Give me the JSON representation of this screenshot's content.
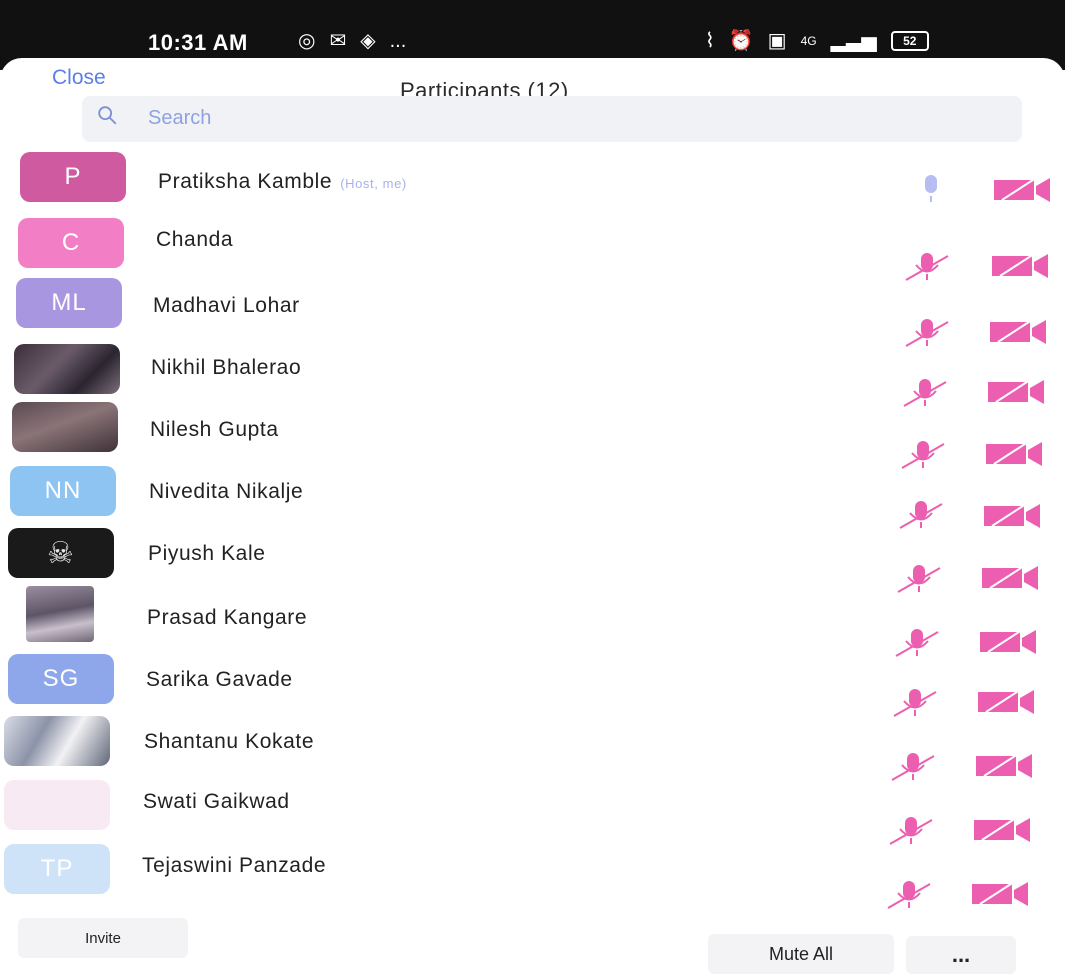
{
  "status_bar": {
    "time": "10:31 AM",
    "dots": "...",
    "network": "4G",
    "battery": "52"
  },
  "header": {
    "close_label": "Close",
    "title": "Participants (12)"
  },
  "search": {
    "placeholder": "Search"
  },
  "participants": [
    {
      "name": "Pratiksha Kamble",
      "tag": "(Host, me)",
      "initials": "P",
      "avatar_color": "#cf5aa0",
      "mic": "on",
      "video": "off"
    },
    {
      "name": "Chanda",
      "initials": "C",
      "avatar_color": "#f27fc5",
      "mic": "off",
      "video": "off"
    },
    {
      "name": "Madhavi Lohar",
      "initials": "ML",
      "avatar_color": "#a996e0",
      "mic": "off",
      "video": "off"
    },
    {
      "name": "Nikhil Bhalerao",
      "avatar_photo": true,
      "mic": "off",
      "video": "off"
    },
    {
      "name": "Nilesh Gupta",
      "avatar_photo": true,
      "mic": "off",
      "video": "off"
    },
    {
      "name": "Nivedita Nikalje",
      "initials": "NN",
      "avatar_color": "#8ec4f2",
      "mic": "off",
      "video": "off"
    },
    {
      "name": "Piyush Kale",
      "avatar_photo": true,
      "mic": "off",
      "video": "off"
    },
    {
      "name": "Prasad Kangare",
      "avatar_photo": true,
      "mic": "off",
      "video": "off"
    },
    {
      "name": "Sarika Gavade",
      "initials": "SG",
      "avatar_color": "#8ea6ea",
      "mic": "off",
      "video": "off"
    },
    {
      "name": "Shantanu Kokate",
      "avatar_photo": true,
      "mic": "off",
      "video": "off"
    },
    {
      "name": "Swati Gaikwad",
      "initials": "",
      "avatar_color": "#f7eaf2",
      "mic": "off",
      "video": "off"
    },
    {
      "name": "Tejaswini Panzade",
      "initials": "TP",
      "avatar_color": "#cfe3f8",
      "mic": "off",
      "video": "off"
    }
  ],
  "footer": {
    "invite_label": "Invite",
    "mute_all_label": "Mute All",
    "more_label": "..."
  },
  "colors": {
    "accent": "#5b7fe6",
    "muted_icon": "#ec5fb0",
    "unmuted_mic": "#b7bdf0"
  }
}
